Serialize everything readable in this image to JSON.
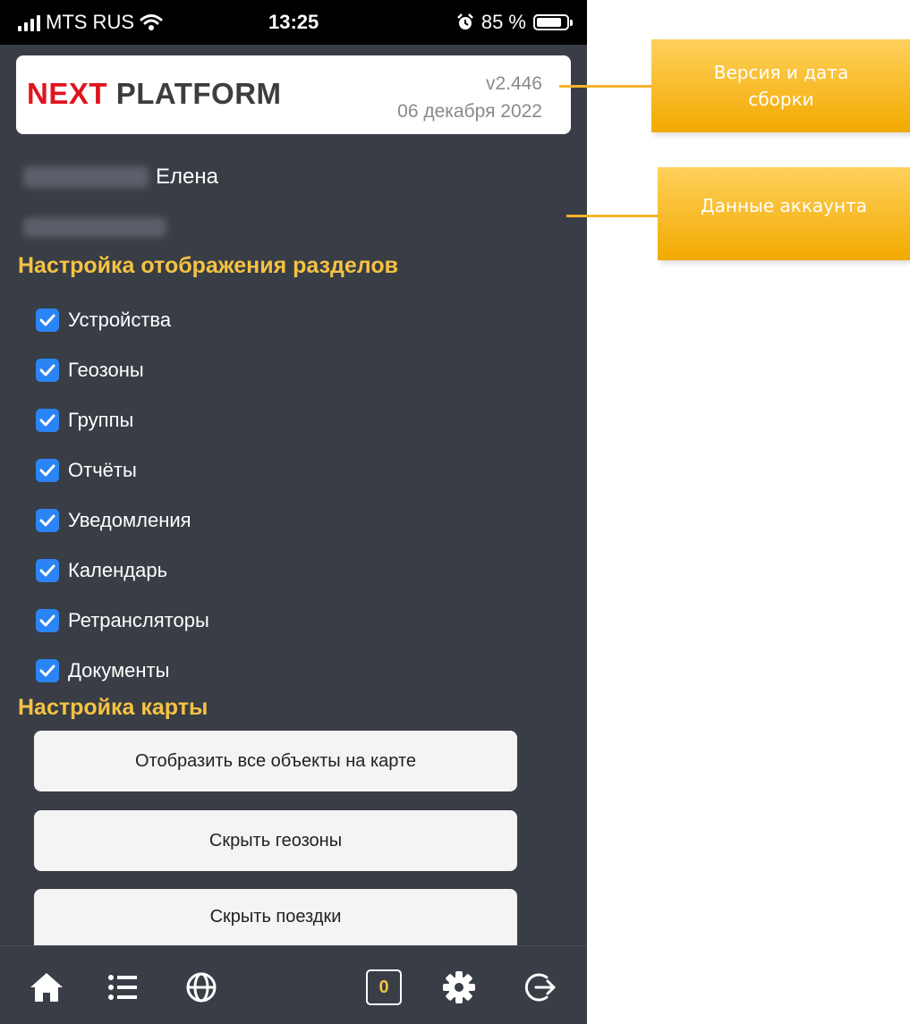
{
  "status_bar": {
    "carrier": "MTS RUS",
    "time": "13:25",
    "battery_percent_label": "85 %",
    "battery_level": 0.85
  },
  "header": {
    "logo_part1": "NEXT",
    "logo_part2": "PLATFORM",
    "version": "v2.446",
    "build_date": "06 декабря 2022"
  },
  "account": {
    "first_name": "Елена"
  },
  "sections_settings": {
    "title": "Настройка отображения разделов",
    "items": [
      {
        "label": "Устройства",
        "checked": true
      },
      {
        "label": "Геозоны",
        "checked": true
      },
      {
        "label": "Группы",
        "checked": true
      },
      {
        "label": "Отчёты",
        "checked": true
      },
      {
        "label": "Уведомления",
        "checked": true
      },
      {
        "label": "Календарь",
        "checked": true
      },
      {
        "label": "Ретрансляторы",
        "checked": true
      },
      {
        "label": "Документы",
        "checked": true
      }
    ]
  },
  "map_settings": {
    "title": "Настройка карты",
    "buttons": [
      {
        "label": "Отобразить все объекты на карте"
      },
      {
        "label": "Скрыть геозоны"
      },
      {
        "label": "Скрыть поездки"
      }
    ]
  },
  "tabbar": {
    "icons": [
      "home-icon",
      "list-icon",
      "globe-icon",
      "counter-badge",
      "gear-icon",
      "logout-icon"
    ],
    "counter": "0"
  },
  "callouts": {
    "version_label": "Версия и дата сборки",
    "account_label": "Данные аккаунта"
  },
  "colors": {
    "background": "#393d45",
    "accent_yellow": "#f5c342",
    "checkbox_blue": "#2a84f5",
    "logo_red": "#e0141e",
    "callout": "#f7b92a"
  }
}
